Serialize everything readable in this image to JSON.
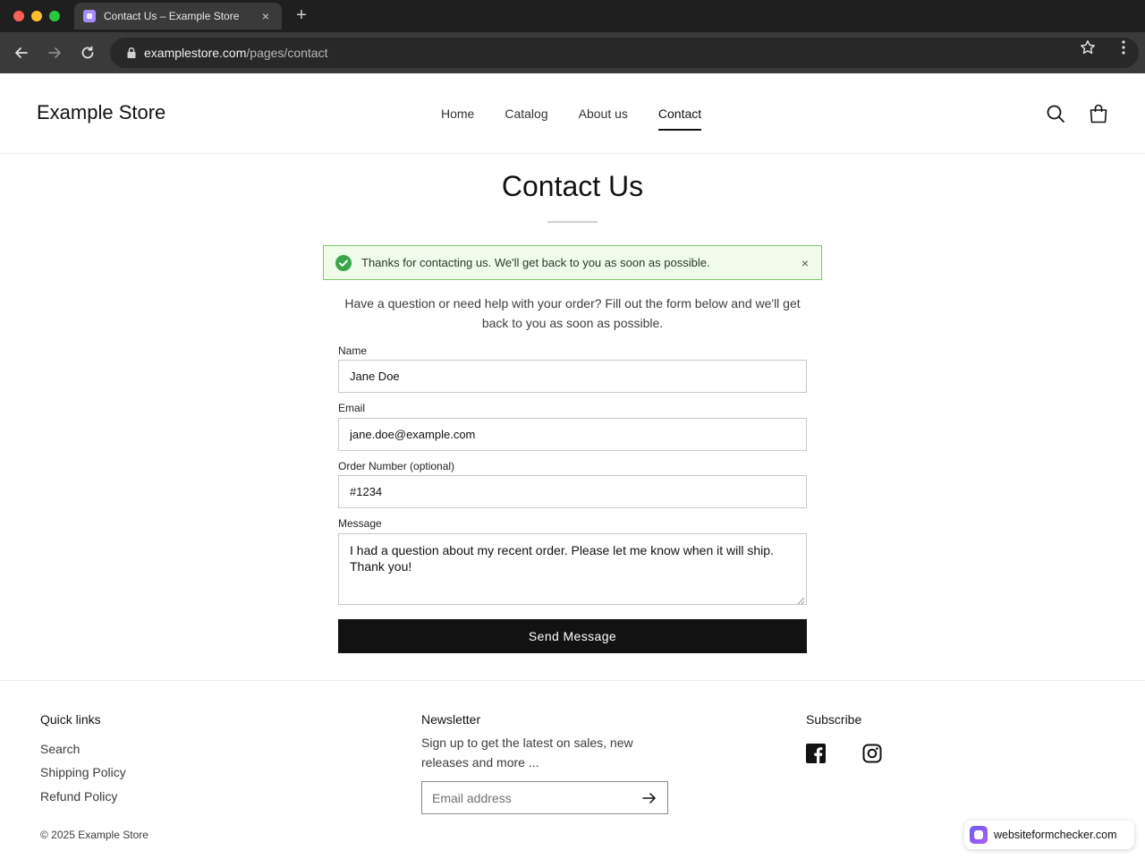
{
  "browser": {
    "tab_title": "Contact Us – Example Store",
    "tab_close": "×",
    "new_tab": "+",
    "url_host": "examplestore.com",
    "url_path": "/pages/contact"
  },
  "header": {
    "logo": "Example Store",
    "nav": [
      {
        "label": "Home",
        "active": false
      },
      {
        "label": "Catalog",
        "active": false
      },
      {
        "label": "About us",
        "active": false
      },
      {
        "label": "Contact",
        "active": true
      }
    ],
    "icons": [
      "search-icon",
      "cart-icon"
    ]
  },
  "main": {
    "title": "Contact Us",
    "alert": {
      "text": "Thanks for contacting us. We'll get back to you as soon as possible.",
      "close": "×",
      "color": "#7ec86b",
      "icon": "check-circle-icon"
    },
    "intro": "Have a question or need help with your order? Fill out the form below and we'll get back to you as soon as possible.",
    "form": {
      "name_label": "Name",
      "name_value": "Jane Doe",
      "email_label": "Email",
      "email_value": "jane.doe@example.com",
      "order_label": "Order Number (optional)",
      "order_value": "#1234",
      "message_label": "Message",
      "message_value": "I had a question about my recent order. Please let me know when it will ship. Thank you!",
      "submit_label": "Send Message"
    }
  },
  "footer": {
    "quick_links_heading": "Quick links",
    "quick_links": [
      "Search",
      "Shipping Policy",
      "Refund Policy"
    ],
    "newsletter_heading": "Newsletter",
    "newsletter_text": "Sign up to get the latest on sales, new releases and more ...",
    "email_placeholder": "Email address",
    "subscribe_heading": "Subscribe",
    "social": [
      "facebook-icon",
      "instagram-icon"
    ],
    "copyright": "© 2025 Example Store"
  },
  "badge": {
    "text": "websiteformchecker.com"
  }
}
